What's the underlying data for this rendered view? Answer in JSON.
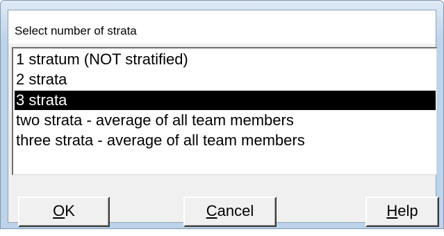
{
  "dialog": {
    "title": "Select number of strata"
  },
  "list": {
    "items": [
      {
        "label": "1 stratum (NOT stratified)",
        "selected": false
      },
      {
        "label": "2 strata",
        "selected": false
      },
      {
        "label": "3 strata",
        "selected": true
      },
      {
        "label": "two strata - average of all team members",
        "selected": false
      },
      {
        "label": "three strata - average of all team members",
        "selected": false
      }
    ]
  },
  "buttons": {
    "ok": {
      "mnemonic": "O",
      "rest": "K"
    },
    "cancel": {
      "mnemonic": "C",
      "rest": "ancel"
    },
    "help": {
      "mnemonic": "H",
      "rest": "elp"
    }
  }
}
